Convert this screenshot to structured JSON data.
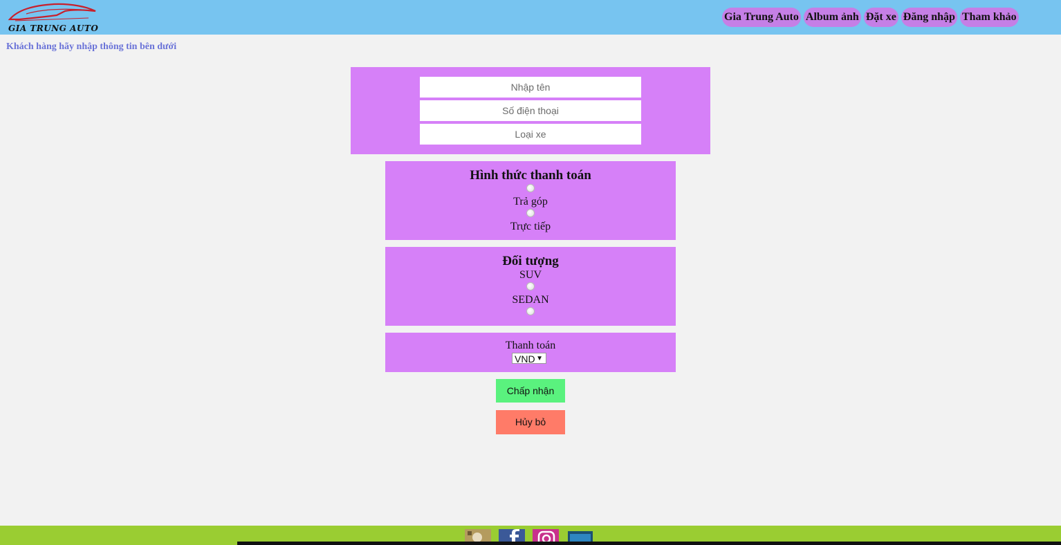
{
  "header": {
    "logo_text": "GIA TRUNG AUTO",
    "nav": [
      "Gia Trung Auto",
      "Album ảnh",
      "Đặt xe",
      "Đăng nhập",
      "Tham khảo"
    ]
  },
  "intro_text": "Khách hàng hãy nhập thông tin bên dưới",
  "form": {
    "name_placeholder": "Nhập tên",
    "phone_placeholder": "Số điện thoại",
    "car_placeholder": "Loại xe",
    "payment": {
      "title": "Hình thức thanh toán",
      "options": [
        "Trả góp",
        "Trực tiếp"
      ]
    },
    "object": {
      "title": "Đối tượng",
      "options": [
        "SUV",
        "SEDAN"
      ]
    },
    "currency": {
      "label": "Thanh toán",
      "selected": "VND"
    },
    "accept_label": "Chấp nhận",
    "cancel_label": "Hủy bỏ"
  },
  "footer": {
    "icons": [
      "photo-icon",
      "facebook-icon",
      "instagram-icon",
      "app-icon"
    ]
  },
  "colors": {
    "header": "#77c4f0",
    "nav_pill": "#c57fe6",
    "panel": "#d680f8",
    "accept": "#5af27e",
    "cancel": "#ff7b68",
    "footer": "#9acd32"
  }
}
